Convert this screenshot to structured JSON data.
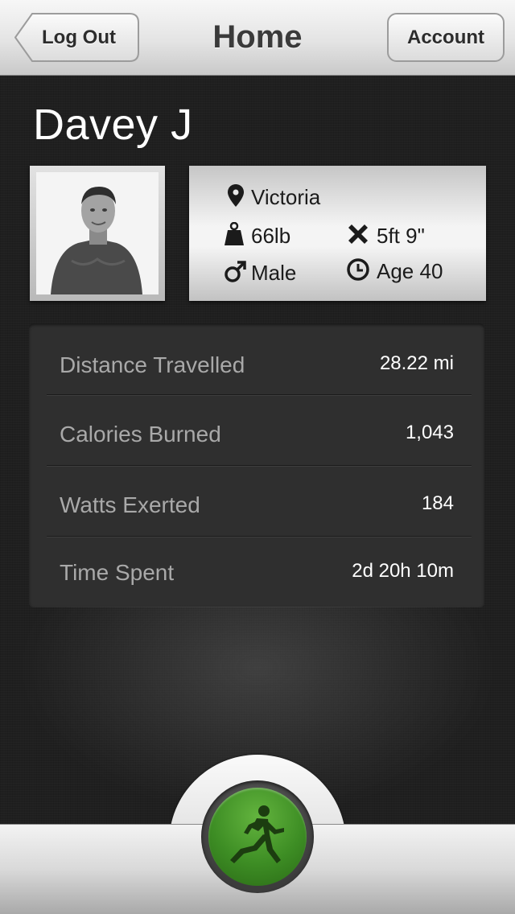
{
  "nav": {
    "title": "Home",
    "back_label": "Log Out",
    "right_label": "Account"
  },
  "profile": {
    "name": "Davey J",
    "avatar_icon": "user-photo",
    "location": "Victoria",
    "weight": "66lb",
    "height": "5ft 9\"",
    "gender": "Male",
    "age": "Age 40"
  },
  "stats": [
    {
      "label": "Distance Travelled",
      "value": "28.22 mi"
    },
    {
      "label": "Calories Burned",
      "value": "1,043"
    },
    {
      "label": "Watts Exerted",
      "value": "184"
    },
    {
      "label": "Time Spent",
      "value": "2d 20h 10m"
    }
  ],
  "action": {
    "icon": "runner-icon",
    "color": "#3d8d24"
  }
}
